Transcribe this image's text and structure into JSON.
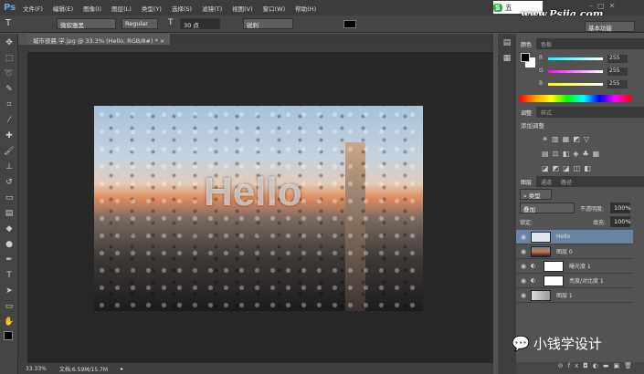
{
  "app": {
    "logo": "Ps"
  },
  "menu": [
    "文件(F)",
    "编辑(E)",
    "图像(I)",
    "图层(L)",
    "类型(Y)",
    "选择(S)",
    "滤镜(T)",
    "视图(V)",
    "窗口(W)",
    "帮助(H)"
  ],
  "options": {
    "font_family": "微软雅黑",
    "font_style": "Regular",
    "font_size": "30 点",
    "antialias": "锐利",
    "workspace": "基本功能",
    "text_color": "#000000"
  },
  "ime": {
    "mode": "五"
  },
  "watermark": "www.Psjia.com",
  "document": {
    "tab": "城市夜晨.学.jpg @ 33.3% (Hello, RGB/8#) *",
    "close": "×",
    "image_text": "Hello"
  },
  "status": {
    "zoom": "33.33%",
    "doc": "文档:6.59M/15.7M"
  },
  "color_panel": {
    "tabs": [
      "颜色",
      "色板"
    ],
    "r_label": "R",
    "g_label": "G",
    "b_label": "B",
    "r": "255",
    "g": "255",
    "b": "255"
  },
  "adjust_panel": {
    "tabs": [
      "调整",
      "样式"
    ],
    "title": "添加调整"
  },
  "layers_panel": {
    "tabs": [
      "图层",
      "通道",
      "路径"
    ],
    "filter": "类型",
    "blend": "叠加",
    "opacity_label": "不透明度:",
    "opacity": "100%",
    "lock_label": "锁定:",
    "fill_label": "填充:",
    "fill": "100%",
    "layers": [
      {
        "name": "Hello",
        "selected": true
      },
      {
        "name": "图层 0"
      },
      {
        "name": "曝光度 1"
      },
      {
        "name": "亮度/对比度 1"
      },
      {
        "name": "图层 1"
      }
    ]
  },
  "wechat": "小钱学设计"
}
